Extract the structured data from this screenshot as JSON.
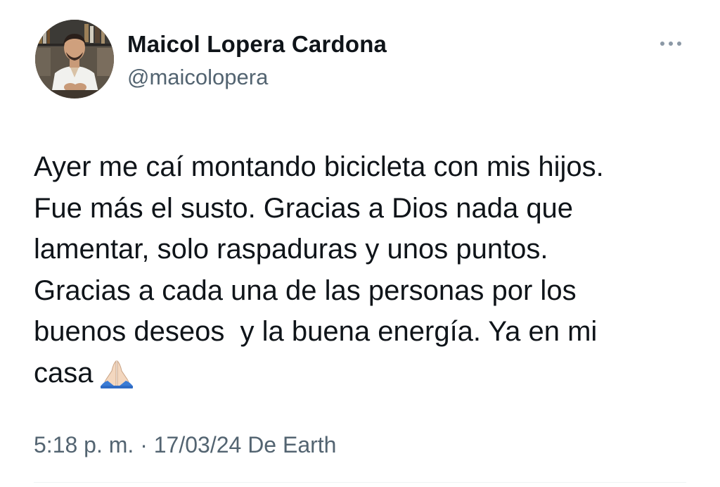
{
  "author": {
    "display_name": "Maicol Lopera Cardona",
    "handle": "@maicolopera",
    "avatar_icon": "profile-photo"
  },
  "more_icon": "more-horizontal-icon",
  "tweet": {
    "lines": [
      "Ayer me caí montando bicicleta con mis hijos.",
      "Fue más el susto. Gracias a Dios nada que",
      "lamentar, solo raspaduras y unos puntos.",
      "Gracias a cada una de las personas por los",
      "buenos deseos  y la buena energía. Ya en mi",
      "casa"
    ],
    "emoji": "🙏🏻",
    "emoji_icon": "folded-hands-icon"
  },
  "meta": {
    "time": "5:18 p. m.",
    "separator": "·",
    "date": "17/03/24",
    "source": "De Earth"
  },
  "colors": {
    "text_primary": "#0f1419",
    "text_secondary": "#536471",
    "background": "#ffffff"
  }
}
